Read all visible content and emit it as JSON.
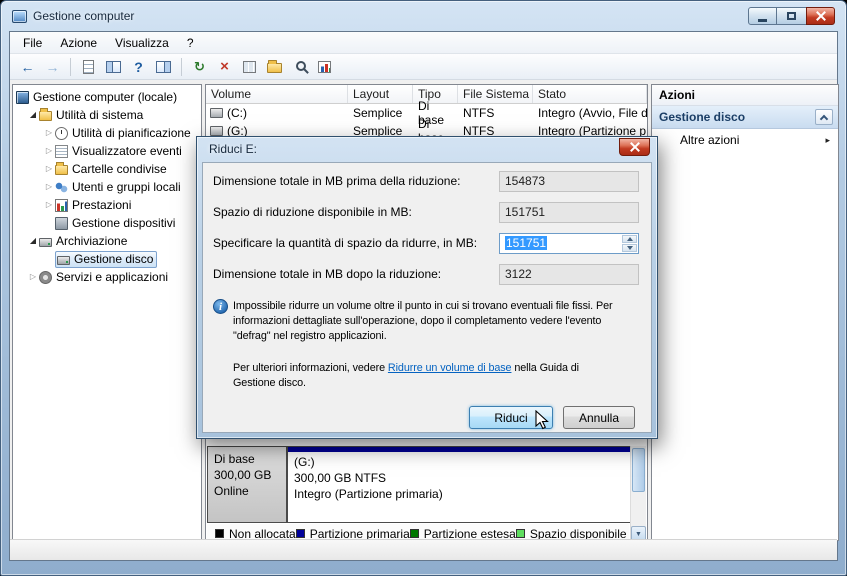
{
  "window": {
    "title": "Gestione computer",
    "menu": [
      "File",
      "Azione",
      "Visualizza",
      "?"
    ]
  },
  "icons": {
    "twisty_expanded": "◢",
    "twisty_collapsed": "▷",
    "submenu_arrow": "▸",
    "scroll_down_arrow": "▼"
  },
  "toolbar": {
    "icons": [
      {
        "name": "back",
        "glyph": "←"
      },
      {
        "name": "forward",
        "glyph": "→"
      },
      {
        "name": "export-list",
        "glyph": ""
      },
      {
        "name": "show-console-tree",
        "glyph": ""
      },
      {
        "name": "help",
        "glyph": "?"
      },
      {
        "name": "show-action-pane",
        "glyph": ""
      },
      {
        "name": "refresh",
        "glyph": "↻"
      },
      {
        "name": "delete",
        "glyph": "×"
      },
      {
        "name": "paste",
        "glyph": ""
      },
      {
        "name": "open-folder",
        "glyph": ""
      },
      {
        "name": "find",
        "glyph": ""
      },
      {
        "name": "chart",
        "glyph": ""
      }
    ]
  },
  "tree": {
    "items": [
      {
        "label": "Gestione computer (locale)",
        "level": 0,
        "state": "none"
      },
      {
        "label": "Utilità di sistema",
        "level": 1,
        "state": "expanded"
      },
      {
        "label": "Utilità di pianificazione",
        "level": 2,
        "state": "collapsed"
      },
      {
        "label": "Visualizzatore eventi",
        "level": 2,
        "state": "collapsed"
      },
      {
        "label": "Cartelle condivise",
        "level": 2,
        "state": "collapsed"
      },
      {
        "label": "Utenti e gruppi locali",
        "level": 2,
        "state": "collapsed"
      },
      {
        "label": "Prestazioni",
        "level": 2,
        "state": "collapsed"
      },
      {
        "label": "Gestione dispositivi",
        "level": 2,
        "state": "none"
      },
      {
        "label": "Archiviazione",
        "level": 1,
        "state": "expanded"
      },
      {
        "label": "Gestione disco",
        "level": 2,
        "state": "none",
        "selected": true
      },
      {
        "label": "Servizi e applicazioni",
        "level": 1,
        "state": "collapsed"
      }
    ]
  },
  "volume_list": {
    "columns": [
      "Volume",
      "Layout",
      "Tipo",
      "File Sistema",
      "Stato"
    ],
    "rows": [
      [
        "(C:)",
        "Semplice",
        "Di base",
        "NTFS",
        "Integro (Avvio, File d"
      ],
      [
        "(G:)",
        "Semplice",
        "Di base",
        "NTFS",
        "Integro (Partizione p"
      ]
    ]
  },
  "actions": {
    "title": "Azioni",
    "section_title": "Gestione disco",
    "more_actions": "Altre azioni"
  },
  "dialog": {
    "title": "Riduci E:",
    "rows": [
      {
        "label": "Dimensione totale in MB prima della riduzione:",
        "value": "154873"
      },
      {
        "label": "Spazio di riduzione disponibile in MB:",
        "value": "151751"
      },
      {
        "label": "Specificare la quantità di spazio da ridurre, in MB:",
        "value": "151751"
      },
      {
        "label": "Dimensione totale in MB dopo la riduzione:",
        "value": "3122"
      }
    ],
    "info_text": "Impossibile ridurre un volume oltre il punto in cui si trovano eventuali file fissi. Per\ninformazioni dettagliate sull'operazione, dopo il completamento vedere l'evento\n\"defrag\" nel registro applicazioni.",
    "help_before": "Per ulteriori informazioni, vedere ",
    "help_link": "Ridurre un volume di base",
    "help_after": " nella Guida di",
    "help_line2": "Gestione disco.",
    "shrink_button": "Riduci",
    "cancel_button": "Annulla"
  },
  "disk_view": {
    "disk_type": "Di base",
    "disk_size": "300,00 GB",
    "disk_status": "Online",
    "volume_title": "(G:)",
    "volume_size": "300,00 GB NTFS",
    "volume_status": "Integro (Partizione primaria)",
    "partition_color": "#000099"
  },
  "legend": {
    "items": [
      {
        "label": "Non allocata",
        "color": "#000000"
      },
      {
        "label": "Partizione primaria",
        "color": "#000099"
      },
      {
        "label": "Partizione estesa",
        "color": "#007800"
      },
      {
        "label": "Spazio disponibile",
        "color": "#5fdd5f"
      }
    ]
  },
  "colors": {
    "selection": "#3399ff",
    "link": "#0563c1"
  }
}
